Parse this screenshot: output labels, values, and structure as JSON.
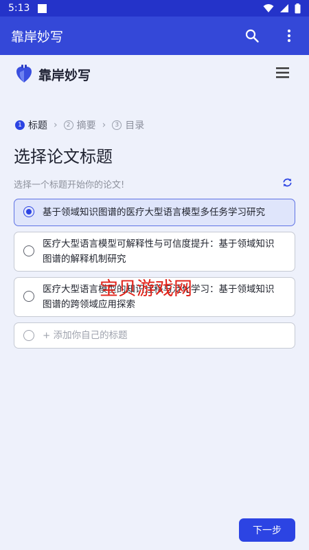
{
  "status_bar": {
    "time": "5:13"
  },
  "app_bar": {
    "title": "靠岸妙写"
  },
  "brand": {
    "name": "靠岸妙写"
  },
  "stepper": {
    "steps": [
      {
        "num": "1",
        "label": "标题"
      },
      {
        "num": "2",
        "label": "摘要"
      },
      {
        "num": "3",
        "label": "目录"
      }
    ],
    "active_index": 0
  },
  "page": {
    "title": "选择论文标题",
    "subtitle": "选择一个标题开始你的论文!"
  },
  "options": [
    {
      "line1": "基于领域知识图谱的医疗大型语言模型多任务学习研究",
      "line2": "",
      "selected": true
    },
    {
      "line1": "医疗大型语言模型可解释性与可信度提升：基于领域知识",
      "line2": "图谱的解释机制研究",
      "selected": false
    },
    {
      "line1": "医疗大型语言模型的知识迁移与泛化学习：基于领域知识",
      "line2": "图谱的跨领域应用探索",
      "selected": false
    }
  ],
  "add_custom": {
    "label": "+ 添加你自己的标题"
  },
  "watermark": {
    "text": "宝贝游戏网"
  },
  "footer": {
    "next_label": "下一步"
  },
  "colors": {
    "status_bar": "#2433c9",
    "app_bar": "#3448d8",
    "accent": "#2c44e3",
    "selected_bg": "#dfe5fb",
    "watermark": "#e2231a"
  },
  "icons": {
    "brand_logo": "heart-logo-icon",
    "search": "search-icon",
    "more": "more-vert-icon",
    "menu": "hamburger-menu-icon",
    "refresh": "refresh-icon"
  }
}
